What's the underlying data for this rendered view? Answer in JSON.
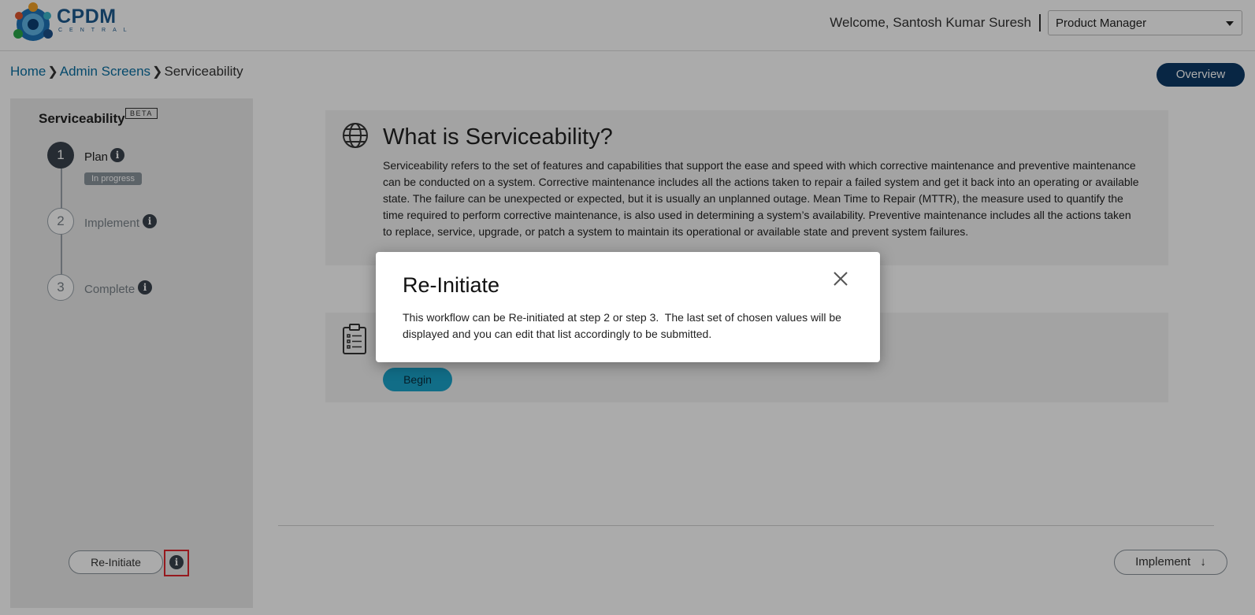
{
  "header": {
    "logo_title": "CPDM",
    "logo_subtitle": "CENTRAL",
    "welcome_text": "Welcome, Santosh Kumar Suresh",
    "role_selected": "Product Manager"
  },
  "breadcrumb": {
    "items": [
      "Home",
      "Admin Screens"
    ],
    "current": "Serviceability"
  },
  "overview_label": "Overview",
  "sidebar": {
    "title": "Serviceability",
    "badge": "BETA",
    "steps": [
      {
        "number": "1",
        "label": "Plan",
        "status": "In progress"
      },
      {
        "number": "2",
        "label": "Implement"
      },
      {
        "number": "3",
        "label": "Complete"
      }
    ],
    "reinitiate_label": "Re-Initiate",
    "info_glyph": "i"
  },
  "main": {
    "card_title": "What is Serviceability?",
    "card_body": "Serviceability refers to the set of features and capabilities that support the ease and speed with which corrective maintenance and preventive maintenance can be conducted on a system. Corrective maintenance includes all the actions taken to repair a failed system and get it back into an operating or available state. The failure can be unexpected or expected, but it is usually an unplanned outage. Mean Time to Repair (MTTR), the measure used to quantify the time required to perform corrective maintenance, is also used in determining a system’s availability. Preventive maintenance includes all the actions taken to replace, service, upgrade, or patch a system to maintain its operational or available state and prevent system failures.",
    "begin_label": "Begin",
    "implement_label": "Implement"
  },
  "modal": {
    "title": "Re-Initiate",
    "body": "This workflow can be Re-initiated at step 2 or step 3.  The last set of chosen values will be displayed and you can edit that list accordingly to be submitted."
  },
  "icons": {
    "globe": "globe-icon",
    "clipboard": "clipboard-list-icon",
    "close": "close-icon",
    "arrow": "arrow-down-icon"
  },
  "colors": {
    "primary_dark": "#0c3a66",
    "accent": "#1aa3c9",
    "link": "#0a6fa1",
    "annotation": "#e0262d"
  }
}
